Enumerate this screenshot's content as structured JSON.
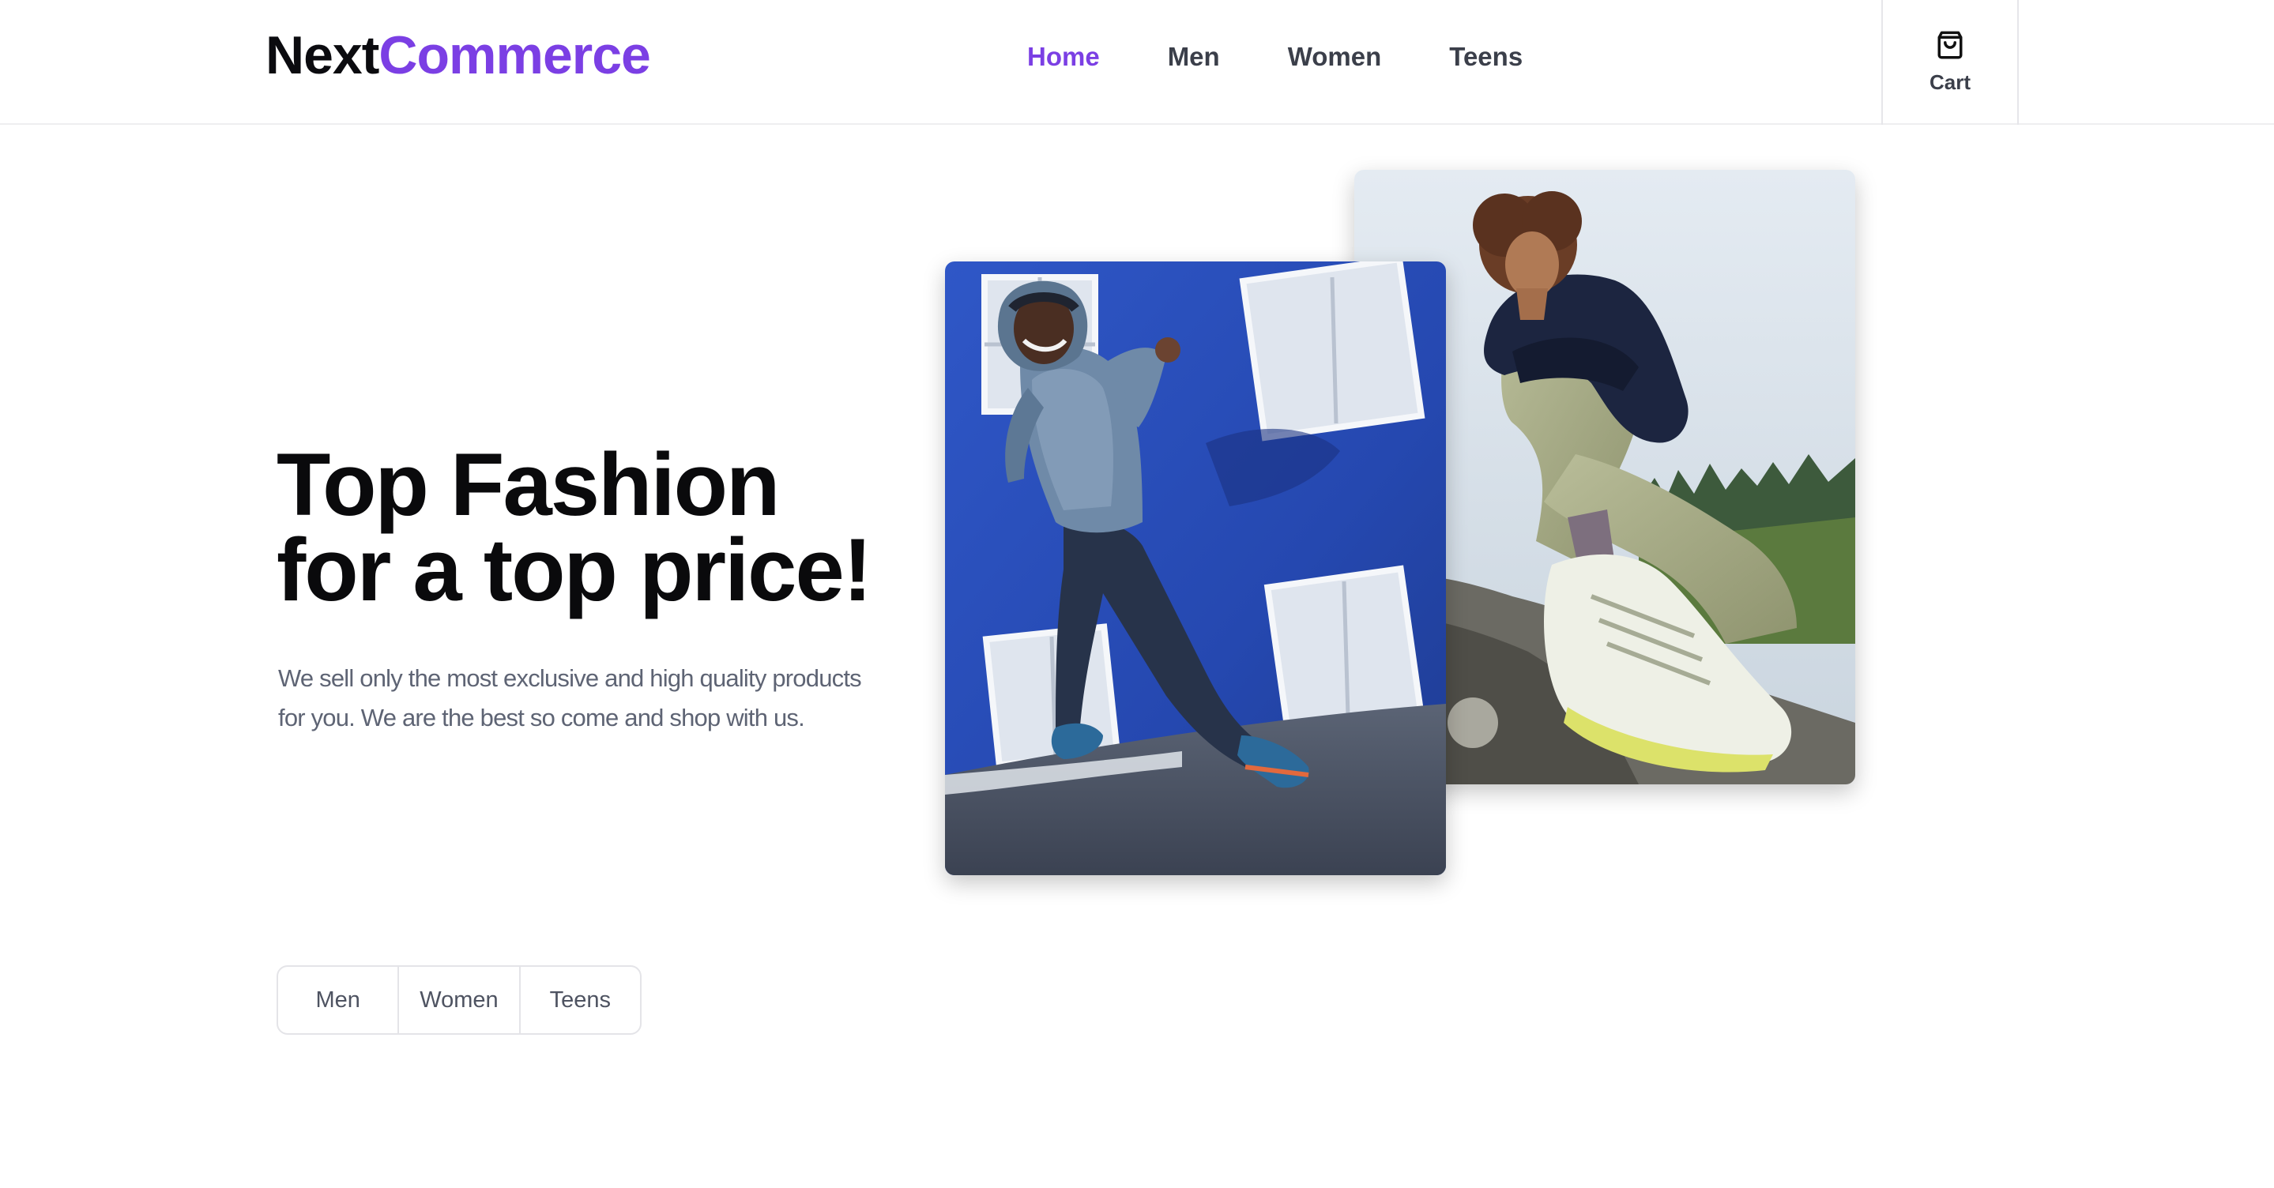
{
  "brand": {
    "part1": "Next",
    "part2": "Commerce"
  },
  "nav": {
    "items": [
      {
        "label": "Home",
        "active": true
      },
      {
        "label": "Men",
        "active": false
      },
      {
        "label": "Women",
        "active": false
      },
      {
        "label": "Teens",
        "active": false
      }
    ]
  },
  "cart": {
    "label": "Cart",
    "icon": "shopping-bag-icon"
  },
  "hero": {
    "title_line1": "Top Fashion",
    "title_line2": "for a top price!",
    "desc_line1": "We sell only the most exclusive and high quality products",
    "desc_line2": "for you. We are the best so come and shop with us."
  },
  "filters": {
    "items": [
      "Men",
      "Women",
      "Teens"
    ]
  },
  "colors": {
    "accent": "#7b3fe4",
    "text": "#0b0b0f",
    "muted": "#5e6474"
  }
}
